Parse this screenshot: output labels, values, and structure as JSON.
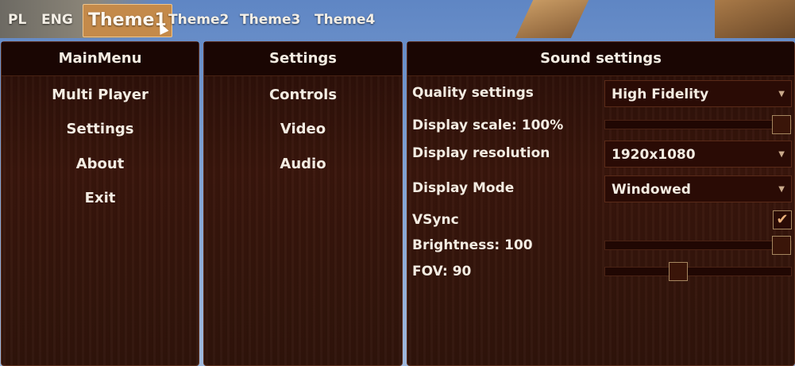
{
  "topbar": {
    "lang_pl": "PL",
    "lang_eng": "ENG",
    "themes": [
      "Theme1",
      "Theme2",
      "Theme3",
      "Theme4"
    ],
    "active_theme": "Theme1"
  },
  "main_menu": {
    "title": "MainMenu",
    "items": [
      "Multi Player",
      "Settings",
      "About",
      "Exit"
    ]
  },
  "settings_menu": {
    "title": "Settings",
    "items": [
      "Controls",
      "Video",
      "Audio"
    ]
  },
  "sound_settings": {
    "title": "Sound settings",
    "quality_label": "Quality settings",
    "quality_value": "High Fidelity",
    "display_scale_label": "Display scale: 100%",
    "display_scale_value": 1.0,
    "display_resolution_label": "Display resolution",
    "display_resolution_value": "1920x1080",
    "display_mode_label": "Display Mode",
    "display_mode_value": "Windowed",
    "vsync_label": "VSync",
    "vsync_checked": true,
    "brightness_label": "Brightness: 100",
    "brightness_value": 1.0,
    "fov_label": "FOV: 90",
    "fov_value": 0.38
  },
  "colors": {
    "panel_bg": "#2a0f08",
    "accent": "#c48a4a",
    "text": "#f3ece2"
  }
}
